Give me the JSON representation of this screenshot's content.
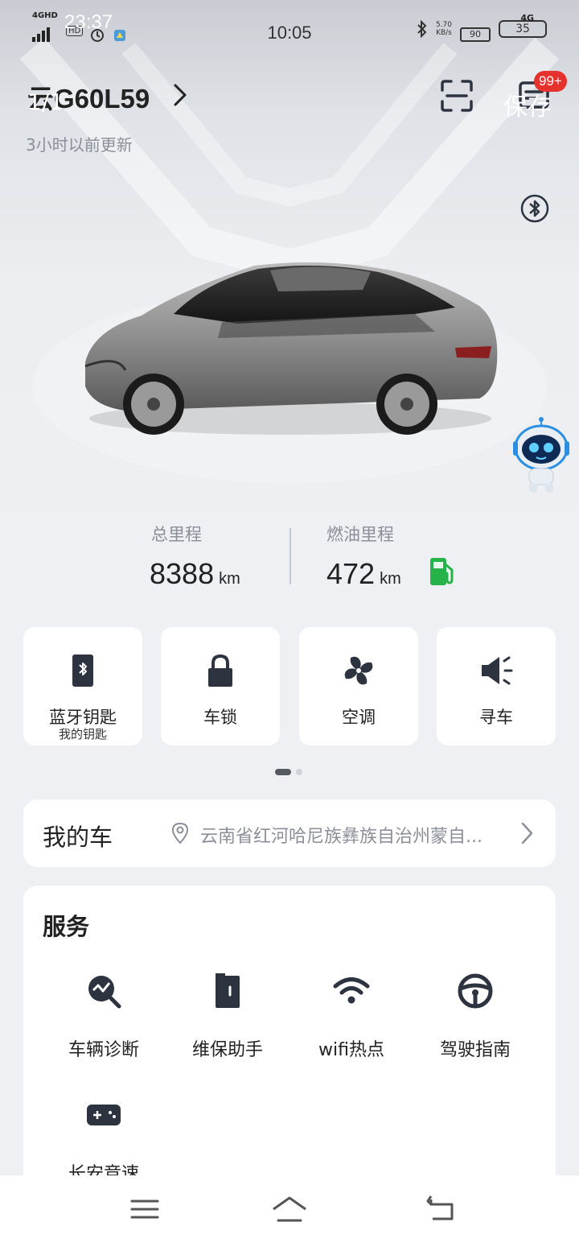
{
  "status_bar": {
    "network_tag": "4GHD",
    "time_overlay": "23:37",
    "hd_label": "HD",
    "clock": "10:05",
    "net_speed_value": "5.70",
    "net_speed_unit": "KB/s",
    "battery_small": "90",
    "network_type": "4G",
    "battery_level": "35"
  },
  "header": {
    "plate": "云G60L59",
    "plate_overlay": "1/1",
    "updated": "3小时以前更新",
    "badge": "99+",
    "save_overlay": "保存"
  },
  "mileage": {
    "total_label": "总里程",
    "total_value": "8388",
    "total_unit": "km",
    "fuel_label": "燃油里程",
    "fuel_value": "472",
    "fuel_unit": "km"
  },
  "quick_actions": [
    {
      "label": "蓝牙钥匙",
      "sublabel": "我的钥匙",
      "icon": "bluetooth-key-icon"
    },
    {
      "label": "车锁",
      "icon": "lock-icon"
    },
    {
      "label": "空调",
      "icon": "fan-icon"
    },
    {
      "label": "寻车",
      "icon": "horn-icon"
    }
  ],
  "pager": {
    "pages": 2,
    "active": 1
  },
  "my_car": {
    "title": "我的车",
    "location": "云南省红河哈尼族彝族自治州蒙自..."
  },
  "services": {
    "title": "服务",
    "items": [
      {
        "label": "车辆诊断",
        "icon": "diagnosis-icon"
      },
      {
        "label": "维保助手",
        "icon": "maintenance-icon"
      },
      {
        "label": "wifi热点",
        "icon": "wifi-icon"
      },
      {
        "label": "驾驶指南",
        "icon": "steering-wheel-icon"
      },
      {
        "label": "长安竞速",
        "icon": "gamepad-icon"
      }
    ]
  },
  "colors": {
    "accent_dark": "#2d3440",
    "badge_red": "#e5322d",
    "fuel_green": "#27b24a",
    "muted_text": "#8a8f98"
  }
}
